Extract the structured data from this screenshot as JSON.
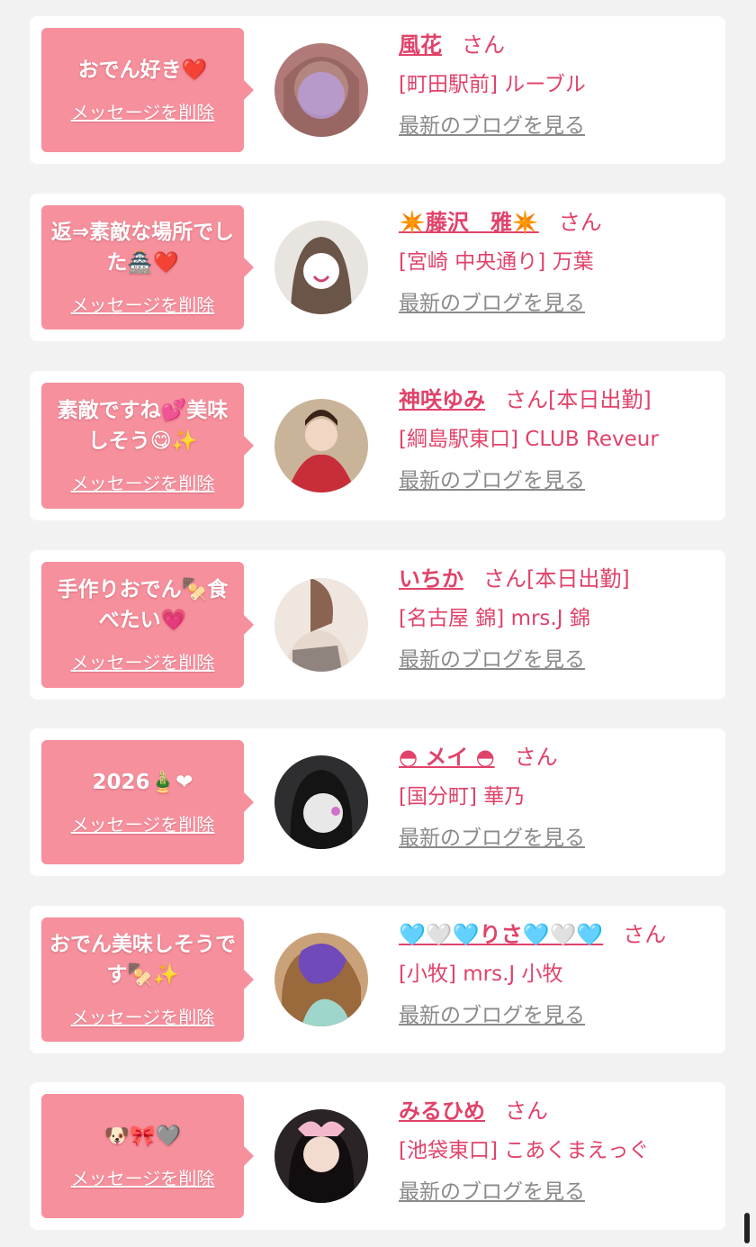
{
  "colors": {
    "accent": "#e0436a",
    "bubble": "#f6909d",
    "link_gray": "#8a8a8a"
  },
  "delete_label": "メッセージを削除",
  "san": "さん",
  "blog_label": "最新のブログを見る",
  "items": [
    {
      "message": "おでん好き❤️",
      "name": "風花",
      "status": "",
      "location": "[町田駅前] ルーブル"
    },
    {
      "message": "返⇒素敵な場所でした🏯❤️",
      "name": "✴️藤沢　雅✴️",
      "status": "",
      "location": "[宮崎 中央通り] 万葉"
    },
    {
      "message": "素敵ですね💕美味しそう😋✨",
      "name": "神咲ゆみ",
      "status": "[本日出勤]",
      "location": "[綱島駅東口] CLUB Reveur"
    },
    {
      "message": "手作りおでん🍢食べたい💗",
      "name": "いちか",
      "status": "[本日出勤]",
      "location": "[名古屋 錦] mrs.J 錦"
    },
    {
      "message": "2026🎍❤",
      "name": "◓ メイ ◓",
      "status": "",
      "location": "[国分町] 華乃"
    },
    {
      "message": "おでん美味しそうです🍢✨",
      "name": "🩵🤍🩵りさ🩵🤍🩵",
      "status": "",
      "location": "[小牧] mrs.J 小牧"
    },
    {
      "message": "🐶🎀🩶",
      "name": "みるひめ",
      "status": "",
      "location": "[池袋東口] こあくまえっぐ"
    }
  ]
}
